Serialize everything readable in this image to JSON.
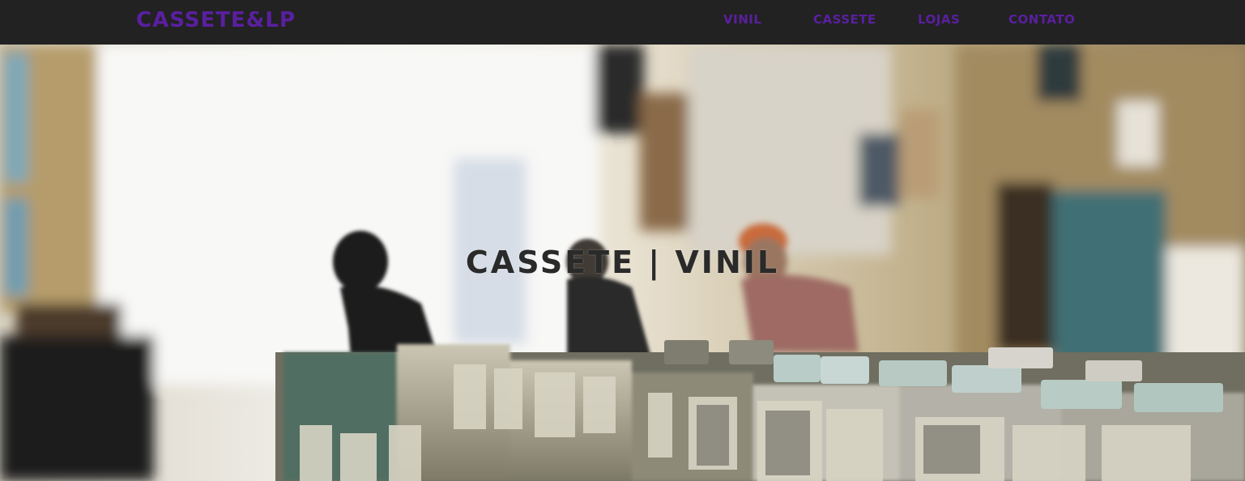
{
  "header": {
    "brand": "CASSETE&LP",
    "nav": {
      "vinil": "VINIL",
      "cassete": "CASSETE",
      "lojas": "LOJAS",
      "contato": "CONTATO"
    }
  },
  "hero": {
    "title": "CASSETE | VINIL",
    "image": "record-store-photo"
  },
  "colors": {
    "header_bg": "#222222",
    "accent": "#5a1fa0",
    "title_text": "#2a2a2a"
  }
}
